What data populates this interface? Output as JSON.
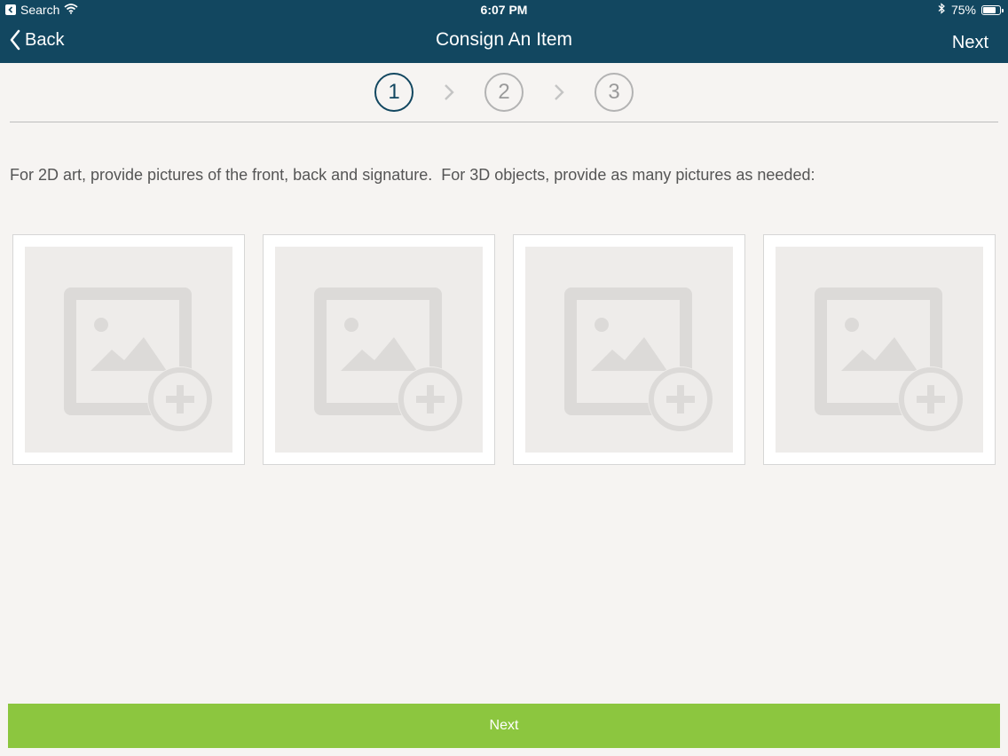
{
  "status_bar": {
    "back_app": "Search",
    "time": "6:07 PM",
    "battery": "75%",
    "battery_level": 0.75
  },
  "nav": {
    "back_label": "Back",
    "title": "Consign An Item",
    "next_label": "Next"
  },
  "steps": {
    "items": [
      "1",
      "2",
      "3"
    ],
    "active_index": 0
  },
  "instructions": "For 2D art, provide pictures of the front, back and signature.  For 3D objects, provide as many pictures as needed:",
  "photo_slots": [
    {
      "icon": "add-photo-icon"
    },
    {
      "icon": "add-photo-icon"
    },
    {
      "icon": "add-photo-icon"
    },
    {
      "icon": "add-photo-icon"
    }
  ],
  "footer": {
    "next_label": "Next"
  },
  "colors": {
    "header_bg": "#124760",
    "accent_green": "#8cc63f",
    "background": "#f6f4f2"
  }
}
